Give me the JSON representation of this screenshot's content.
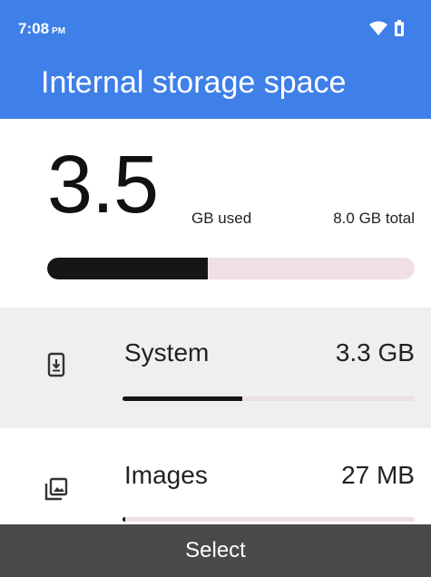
{
  "status_bar": {
    "time": "7:08",
    "ampm": "PM"
  },
  "header": {
    "title": "Internal storage space"
  },
  "summary": {
    "used_value": "3.5",
    "used_unit": "GB used",
    "total": "8.0 GB total",
    "used_fraction": 0.4375
  },
  "categories": [
    {
      "icon": "system-update-icon",
      "label": "System",
      "size": "3.3 GB",
      "fraction": 0.41
    },
    {
      "icon": "images-icon",
      "label": "Images",
      "size": "27 MB",
      "fraction": 0.01
    }
  ],
  "footer": {
    "action_label": "Select"
  },
  "colors": {
    "header": "#3f7fe8",
    "footer": "#494949",
    "bar_fill": "#161616",
    "bar_track": "#efe1e3"
  }
}
